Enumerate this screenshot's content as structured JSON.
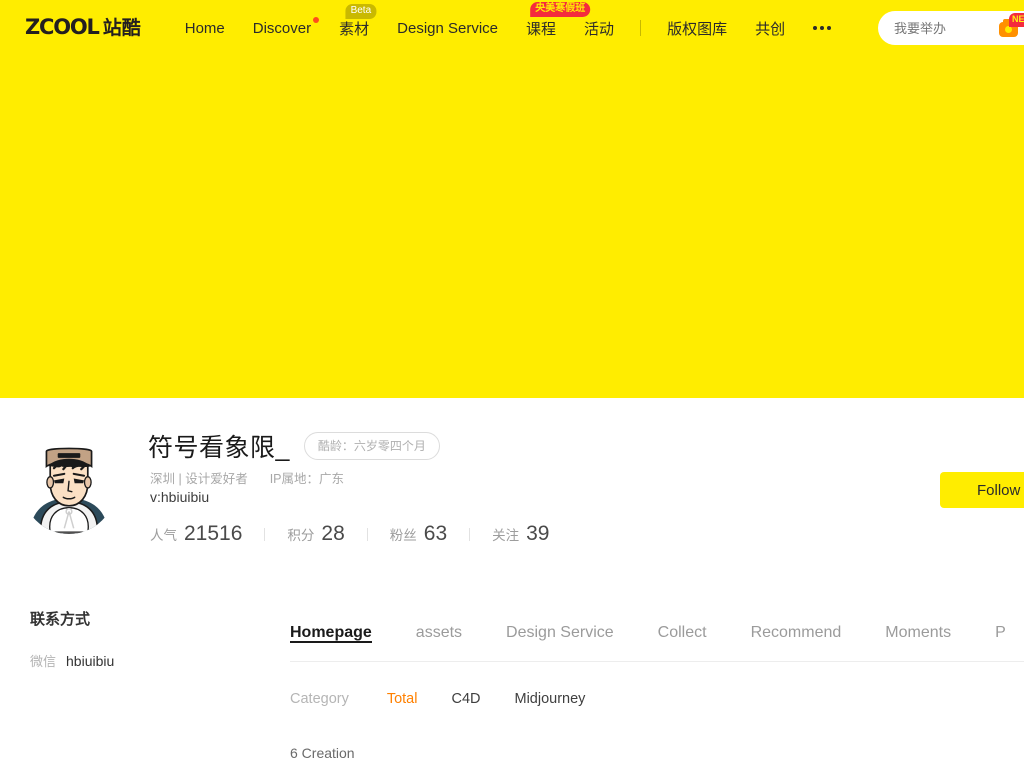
{
  "header": {
    "logo_text": "ZCOOL",
    "logo_text_cn": "站酷",
    "nav": [
      {
        "label": "Home",
        "badge": null,
        "dot": false
      },
      {
        "label": "Discover",
        "badge": null,
        "dot": true
      },
      {
        "label": "素材",
        "badge": "Beta",
        "dot": false
      },
      {
        "label": "Design Service",
        "badge": null,
        "dot": false
      },
      {
        "label": "课程",
        "badge": "央美寒假班",
        "dot": false
      },
      {
        "label": "活动",
        "badge": null,
        "dot": false
      },
      {
        "label": "版权图库",
        "badge": null,
        "dot": false
      },
      {
        "label": "共创",
        "badge": null,
        "dot": false
      }
    ],
    "more_label": "more-menu",
    "search": {
      "value": "我要举办",
      "placeholder": "我要举办",
      "camera_badge": "NEW"
    }
  },
  "profile": {
    "avatar_alt": "user-avatar",
    "username": "符号看象限_",
    "age_badge": "酷龄：六岁零四个月",
    "location": "深圳 | 设计爱好者",
    "ip_location": "IP属地：广东",
    "contact_line": "v:hbiuibiu",
    "stats": [
      {
        "label": "人气",
        "value": "21516"
      },
      {
        "label": "积分",
        "value": "28"
      },
      {
        "label": "粉丝",
        "value": "63"
      },
      {
        "label": "关注",
        "value": "39"
      }
    ],
    "follow_label": "Follow"
  },
  "sidebar": {
    "title": "联系方式",
    "contacts": [
      {
        "key": "微信",
        "value": "hbiuibiu"
      }
    ]
  },
  "main": {
    "tabs": [
      {
        "label": "Homepage",
        "active": true
      },
      {
        "label": "assets",
        "active": false
      },
      {
        "label": "Design Service",
        "active": false
      },
      {
        "label": "Collect",
        "active": false
      },
      {
        "label": "Recommend",
        "active": false
      },
      {
        "label": "Moments",
        "active": false
      },
      {
        "label": "P",
        "active": false
      }
    ],
    "filter_label": "Category",
    "filters": [
      {
        "label": "Total",
        "active": true
      },
      {
        "label": "C4D",
        "active": false
      },
      {
        "label": "Midjourney",
        "active": false
      }
    ],
    "count_text": "6 Creation"
  },
  "colors": {
    "brand_yellow": "#ffed00",
    "accent_orange": "#ff8000",
    "badge_red": "#f42b3d"
  }
}
